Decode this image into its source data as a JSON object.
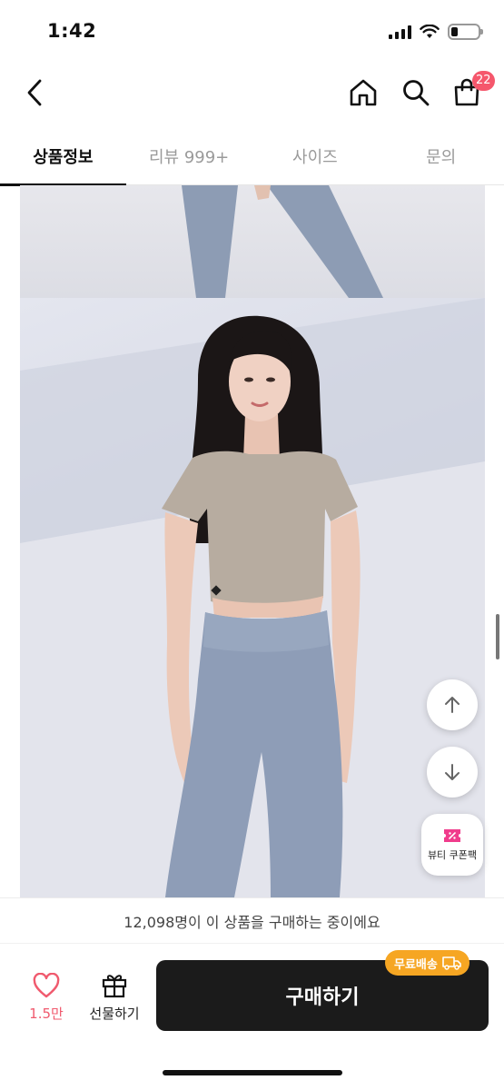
{
  "status_bar": {
    "time": "1:42",
    "battery_level": 0.25
  },
  "header": {
    "cart_badge": "22",
    "icons": [
      "back-icon",
      "home-icon",
      "search-icon",
      "shopping-bag-icon"
    ],
    "badge_color": "#f5576c"
  },
  "tabs": [
    {
      "label": "상품정보",
      "active": true
    },
    {
      "label": "리뷰 999+",
      "active": false
    },
    {
      "label": "사이즈",
      "active": false
    },
    {
      "label": "문의",
      "active": false
    }
  ],
  "floating": {
    "coupon_label": "뷰티 쿠폰팩",
    "icons": [
      "arrow-up-icon",
      "arrow-down-icon",
      "coupon-icon"
    ]
  },
  "purchase_note": "12,098명이 이 상품을 구매하는 중이에요",
  "bottom_bar": {
    "like_count": "1.5만",
    "gift_label": "선물하기",
    "buy_label": "구매하기",
    "free_shipping": "무료배송",
    "like_color": "#f05a6e",
    "badge_color": "#f6a623"
  }
}
